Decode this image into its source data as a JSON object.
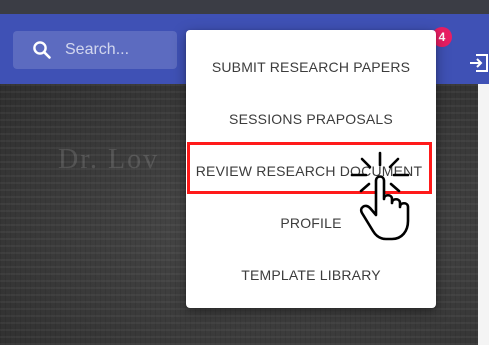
{
  "search": {
    "placeholder": "Search..."
  },
  "notifications": {
    "count": "4"
  },
  "menu": {
    "items": [
      {
        "label": "SUBMIT RESEARCH PAPERS"
      },
      {
        "label": "SESSIONS PRAPOSALS"
      },
      {
        "label": "REVIEW RESEARCH DOCUMENT"
      },
      {
        "label": "PROFILE"
      },
      {
        "label": "TEMPLATE LIBRARY"
      }
    ],
    "highlighted_index": 2
  },
  "background": {
    "faint_text": "Dr. Lov"
  },
  "icons": {
    "search": "search-icon",
    "logout": "logout-icon",
    "pointer": "pointing-hand-icon"
  },
  "colors": {
    "appbar": "#3f51b5",
    "search_box": "#5c6bc0",
    "badge": "#e91e63",
    "highlight": "#ff1a1a"
  }
}
